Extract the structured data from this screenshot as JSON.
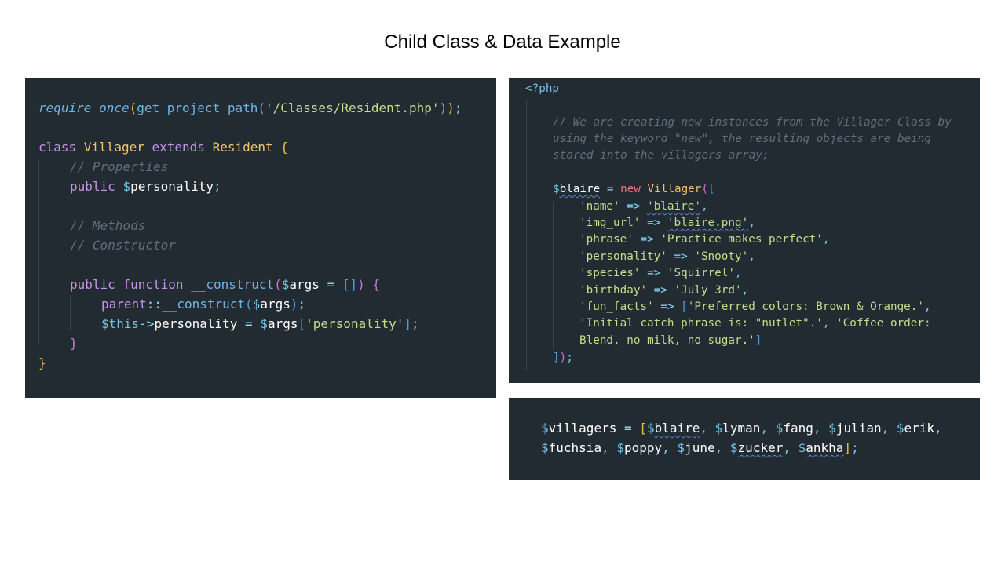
{
  "title": "Child Class & Data Example",
  "left_code": {
    "require_fn": "require_once",
    "path_fn": "get_project_path",
    "path_str": "'/Classes/Resident.php'",
    "kw_class": "class",
    "class_name": "Villager",
    "kw_extends": "extends",
    "parent_name": "Resident",
    "comment_properties": "// Properties",
    "kw_public": "public",
    "prop_name": "personality",
    "comment_methods": "// Methods",
    "comment_constructor": "// Constructor",
    "kw_function": "function",
    "construct_name": "__construct",
    "args_name": "args",
    "kw_parent": "parent",
    "kw_this": "$this",
    "personality_key": "'personality'"
  },
  "right_code": {
    "php_open": "<?php",
    "comment_1": "// We are creating new instances from the Villager Class by",
    "comment_2": "using the keyword \"new\", the resulting objects are being",
    "comment_3": "stored into the villagers array;",
    "var_blaire": "blaire",
    "kw_new": "new",
    "class_name": "Villager",
    "entries": [
      {
        "key": "'name'",
        "value": "'blaire'"
      },
      {
        "key": "'img_url'",
        "value": "'blaire.png'"
      },
      {
        "key": "'phrase'",
        "value": "'Practice makes perfect'"
      },
      {
        "key": "'personality'",
        "value": "'Snooty'"
      },
      {
        "key": "'species'",
        "value": "'Squirrel'"
      },
      {
        "key": "'birthday'",
        "value": "'July 3rd'"
      }
    ],
    "fun_facts_key": "'fun_facts'",
    "fun_fact_1": "'Preferred colors: Brown & Orange.'",
    "fun_fact_2": "'Initial catch phrase is: \"nutlet\".'",
    "fun_fact_3a": "'Coffee order:",
    "fun_fact_3b": "Blend, no milk, no sugar.'"
  },
  "bottom_code": {
    "array_var": "villagers",
    "items": [
      "blaire",
      "lyman",
      "fang",
      "julian",
      "erik",
      "fuchsia",
      "poppy",
      "june",
      "zucker",
      "ankha"
    ]
  }
}
